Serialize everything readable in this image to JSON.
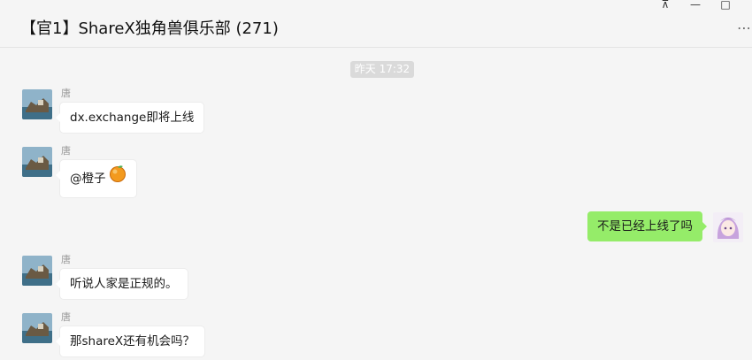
{
  "window": {
    "title": "【官1】ShareX独角兽俱乐部 (271)",
    "pin_icon": "pin-icon",
    "minimize_icon": "minimize-icon",
    "maximize_icon": "maximize-icon",
    "more_icon": "more-icon"
  },
  "timestamp": "昨天 17:32",
  "messages": [
    {
      "sender": "唐",
      "text": "dx.exchange即将上线",
      "side": "left"
    },
    {
      "sender": "唐",
      "text": "@橙子",
      "emoji": "orange-emoji",
      "side": "left"
    },
    {
      "sender": "",
      "text": "不是已经上线了吗",
      "side": "right"
    },
    {
      "sender": "唐",
      "text": "听说人家是正规的。",
      "side": "left"
    },
    {
      "sender": "唐",
      "text": "那shareX还有机会吗？",
      "side": "left"
    }
  ],
  "colors": {
    "background": "#f5f5f5",
    "self_bubble": "#95ec69",
    "other_bubble": "#ffffff",
    "time_badge": "#dadada"
  }
}
